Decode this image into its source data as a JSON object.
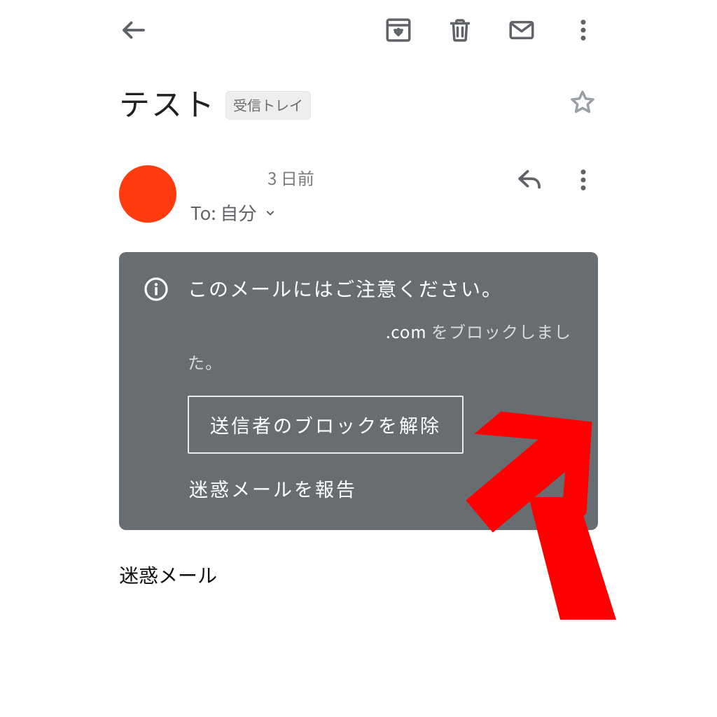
{
  "header": {
    "icons": {
      "back": "back-arrow-icon",
      "archive": "archive-icon",
      "trash": "trash-icon",
      "mail": "mail-icon",
      "more": "more-vert-icon"
    }
  },
  "subject": {
    "title": "テスト",
    "folder_chip": "受信トレイ",
    "star": "star-outline-icon"
  },
  "sender": {
    "avatar_color": "#ff3b10",
    "age_label": "3 日前",
    "to_prefix": "To:",
    "to_target": "自分",
    "reply_icon": "reply-icon",
    "overflow_icon": "more-vert-icon"
  },
  "warning": {
    "info_icon": "info-outline-icon",
    "title": "このメールにはご注意ください。",
    "body_prefix": "",
    "body_strong": ".com",
    "body_suffix": " をブロックしました。",
    "btn_unblock": "送信者のブロックを解除",
    "btn_report": "迷惑メールを報告"
  },
  "body": {
    "text": "迷惑メール"
  },
  "annotation": {
    "color": "#ff0000",
    "shape": "arrow"
  }
}
